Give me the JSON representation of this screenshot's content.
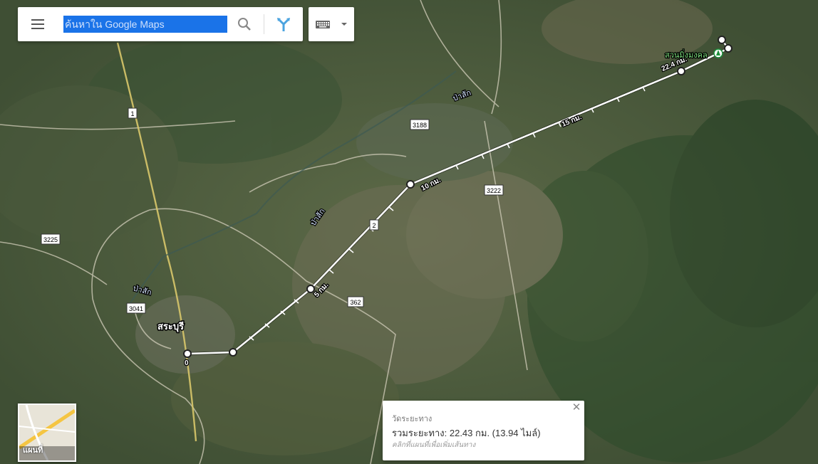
{
  "search": {
    "placeholder": "ค้นหาใน Google Maps"
  },
  "map_labels": {
    "city": "สระบุรี",
    "place": "สวนมิ่งมงคล",
    "river1": "ป่าสัก",
    "river2": "ป่าสัก",
    "river3": "ป่าสัก",
    "minimap": "แผนที่"
  },
  "road_shields": [
    "1",
    "3188",
    "3222",
    "2",
    "362",
    "3225",
    "3041"
  ],
  "distance_markers": {
    "km0": "0",
    "km5": "5 กม.",
    "km10": "10 กม.",
    "km15": "15 กม.",
    "km_end": "22.4 กม."
  },
  "measure_card": {
    "title": "วัดระยะทาง",
    "total": "รวมระยะทาง: 22.43 กม. (13.94 ไมล์)",
    "hint": "คลิกที่แผนที่เพื่อเพิ่มเส้นทาง"
  },
  "colors": {
    "route": "#ffffff",
    "accent": "#1a73e8",
    "directions": "#4aa3df"
  }
}
